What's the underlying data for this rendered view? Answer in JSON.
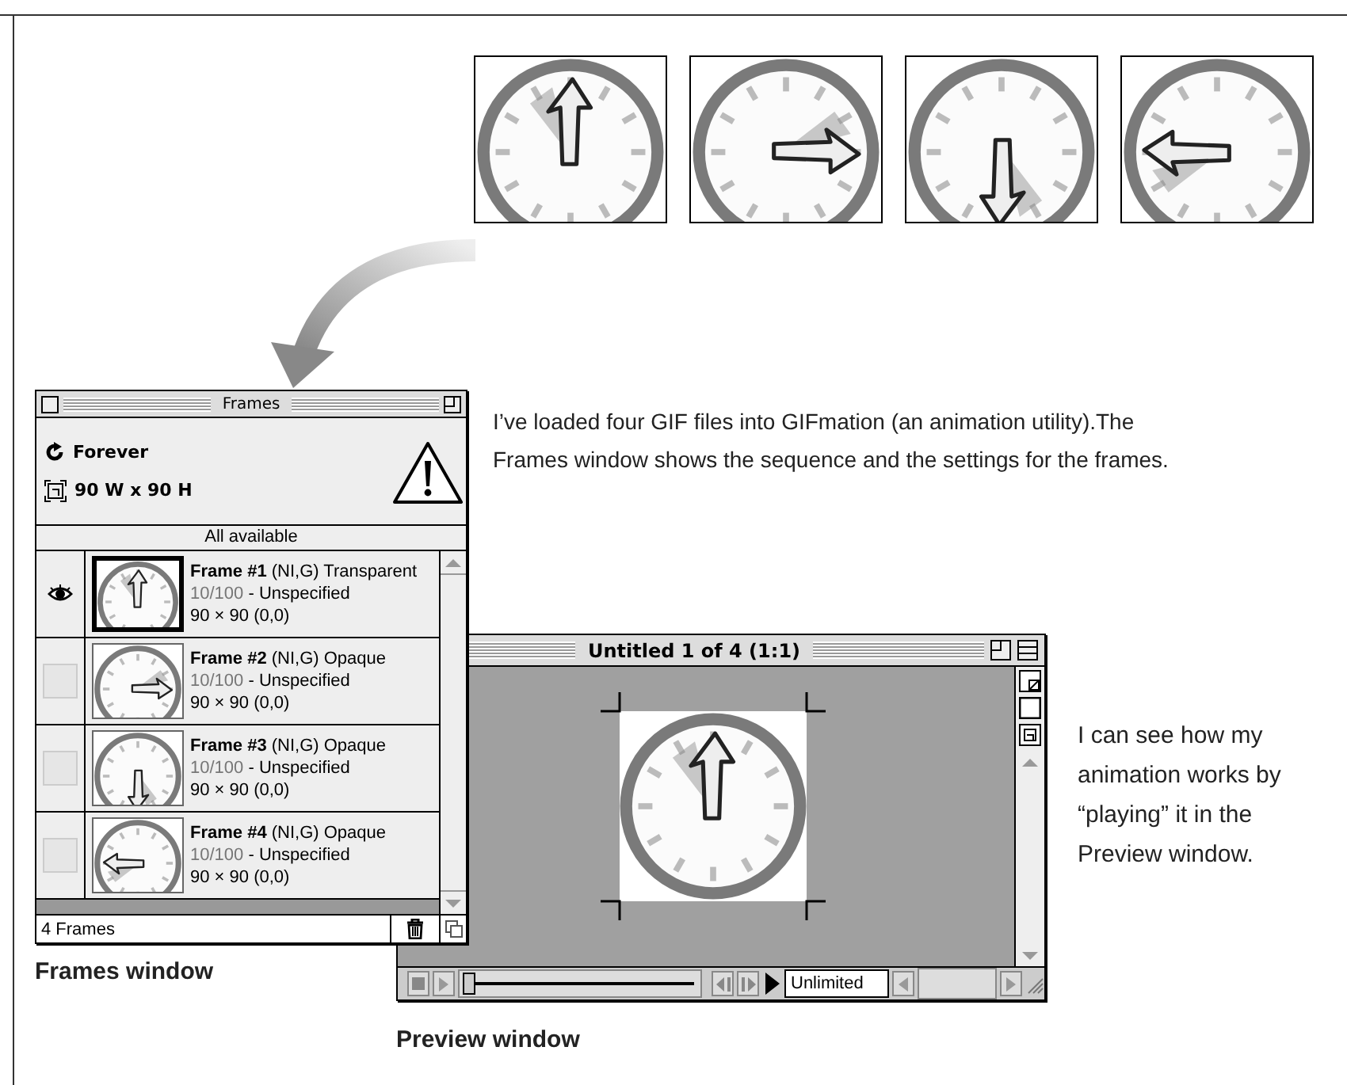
{
  "clock_frames": [
    {
      "kind": "up"
    },
    {
      "kind": "right"
    },
    {
      "kind": "down"
    },
    {
      "kind": "left"
    }
  ],
  "callouts": [
    "I’ve loaded four GIF files into GIFmation (an animation utility).The Frames window shows the sequence and the settings for the frames.",
    "I can see how my animation works by “playing” it in the Preview window."
  ],
  "frames_window": {
    "title": "Frames",
    "loop": "Forever",
    "size": "90 W x 90 H",
    "status": "All available",
    "frames": [
      {
        "title": "**Frame #1** (NI,G) Transparent",
        "delay": "10/100",
        "disposal": "- Unspecified",
        "geometry": "90 × 90 (0,0)",
        "visible": true,
        "selected": true,
        "kind": "up"
      },
      {
        "title": "**Frame #2** (NI,G) Opaque",
        "delay": "10/100",
        "disposal": "- Unspecified",
        "geometry": "90 × 90 (0,0)",
        "visible": false,
        "selected": false,
        "kind": "right"
      },
      {
        "title": "**Frame #3** (NI,G) Opaque",
        "delay": "10/100",
        "disposal": "- Unspecified",
        "geometry": "90 × 90 (0,0)",
        "visible": false,
        "selected": false,
        "kind": "down"
      },
      {
        "title": "**Frame #4** (NI,G) Opaque",
        "delay": "10/100",
        "disposal": "- Unspecified",
        "geometry": "90 × 90 (0,0)",
        "visible": false,
        "selected": false,
        "kind": "left"
      }
    ],
    "footer": "4 Frames"
  },
  "preview_window": {
    "title": "Untitled 1 of 4 (1:1)",
    "kind": "up",
    "level": 0,
    "loop": "Unlimited"
  },
  "captions": [
    "Frames window",
    "Preview window"
  ]
}
